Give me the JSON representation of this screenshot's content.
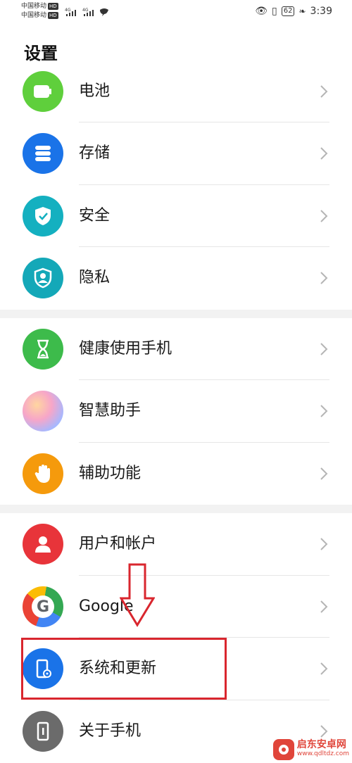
{
  "status_bar": {
    "carrier1": "中国移动",
    "carrier2": "中国移动",
    "hd": "HD",
    "net1": "4G",
    "net2": "4G",
    "battery": "62",
    "time": "3:39"
  },
  "header": {
    "title": "设置"
  },
  "items": [
    {
      "label": "电池",
      "color": "#3dbb4b",
      "icon": "battery-icon"
    },
    {
      "label": "存储",
      "color": "#1a73e8",
      "icon": "storage-icon"
    },
    {
      "label": "安全",
      "color": "#14b0c0",
      "icon": "shield-check-icon"
    },
    {
      "label": "隐私",
      "color": "#14a8b8",
      "icon": "privacy-icon"
    },
    {
      "label": "健康使用手机",
      "color": "#3dbb4b",
      "icon": "hourglass-icon"
    },
    {
      "label": "智慧助手",
      "color": "#f0a0c0",
      "icon": "assistant-icon"
    },
    {
      "label": "辅助功能",
      "color": "#f59a0c",
      "icon": "hand-icon"
    },
    {
      "label": "用户和帐户",
      "color": "#e8343a",
      "icon": "user-icon"
    },
    {
      "label": "Google",
      "color": "#ffffff",
      "icon": "google-icon"
    },
    {
      "label": "系统和更新",
      "color": "#1a73e8",
      "icon": "system-update-icon"
    },
    {
      "label": "关于手机",
      "color": "#6b6b6b",
      "icon": "phone-info-icon"
    }
  ],
  "watermark": {
    "name": "启东安卓网",
    "url": "www.qdltdz.com"
  },
  "colors": {
    "highlight": "#d9262e",
    "accent": "#1a73e8"
  }
}
